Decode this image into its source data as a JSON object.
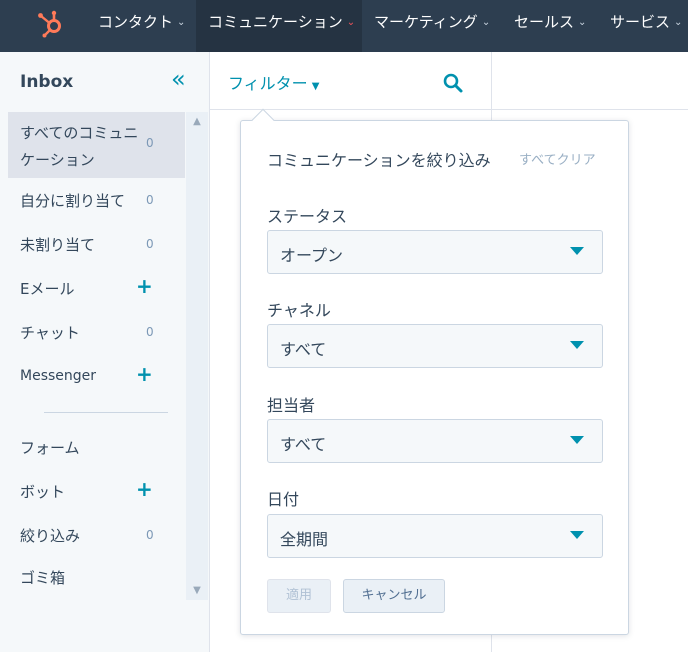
{
  "nav": {
    "items": [
      {
        "label": "コンタクト"
      },
      {
        "label": "コミュニケーション"
      },
      {
        "label": "マーケティング"
      },
      {
        "label": "セールス"
      },
      {
        "label": "サービス"
      }
    ],
    "active_index": 1
  },
  "sidebar": {
    "title": "Inbox",
    "items": [
      {
        "label": "すべてのコミュニケーション",
        "count": "0"
      },
      {
        "label": "自分に割り当て",
        "count": "0"
      },
      {
        "label": "未割り当て",
        "count": "0"
      },
      {
        "label": "Eメール",
        "action": "+"
      },
      {
        "label": "チャット",
        "count": "0"
      },
      {
        "label": "Messenger",
        "action": "+"
      },
      {
        "label": "フォーム"
      },
      {
        "label": "ボット",
        "action": "+"
      },
      {
        "label": "絞り込み",
        "count": "0"
      },
      {
        "label": "ゴミ箱"
      }
    ],
    "selected_index": 0
  },
  "toolbar": {
    "filter_label": "フィルター"
  },
  "filter_panel": {
    "title": "コミュニケーションを絞り込み",
    "clear_all": "すべてクリア",
    "fields": [
      {
        "label": "ステータス",
        "value": "オープン"
      },
      {
        "label": "チャネル",
        "value": "すべて"
      },
      {
        "label": "担当者",
        "value": "すべて"
      },
      {
        "label": "日付",
        "value": "全期間"
      }
    ],
    "apply_label": "適用",
    "cancel_label": "キャンセル"
  },
  "colors": {
    "nav_bg": "#2d3e50",
    "accent": "#0091ae",
    "logo": "#ff7a59"
  },
  "icons": {
    "logo": "hubspot-sprocket-icon",
    "search": "search-icon",
    "collapse": "double-chevron-left-icon",
    "dropdown": "caret-down-icon"
  }
}
